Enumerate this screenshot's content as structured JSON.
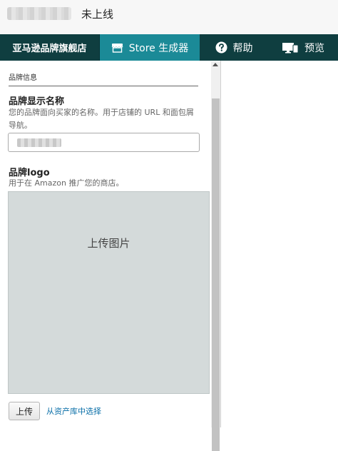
{
  "header": {
    "status": "未上线"
  },
  "nav": {
    "brand": "亚马逊品牌旗舰店",
    "store_builder": "Store 生成器",
    "help": "帮助",
    "preview": "预览",
    "active_color": "#1b8a97",
    "bar_color": "#0f3e40"
  },
  "panel": {
    "section_title": "品牌信息",
    "brand_name": {
      "label": "品牌显示名称",
      "help": "您的品牌面向买家的名称。用于店铺的 URL 和面包屑导航。"
    },
    "brand_logo": {
      "label": "品牌logo",
      "help": "用于在 Amazon 推广您的商店。",
      "upload_area_label": "上传图片",
      "upload_button": "上传",
      "library_link": "从资产库中选择"
    }
  },
  "icons": {
    "store": "store-icon",
    "help": "help-circle-icon",
    "preview": "monitor-devices-icon",
    "scroll_up": "scroll-up-arrow-icon"
  }
}
